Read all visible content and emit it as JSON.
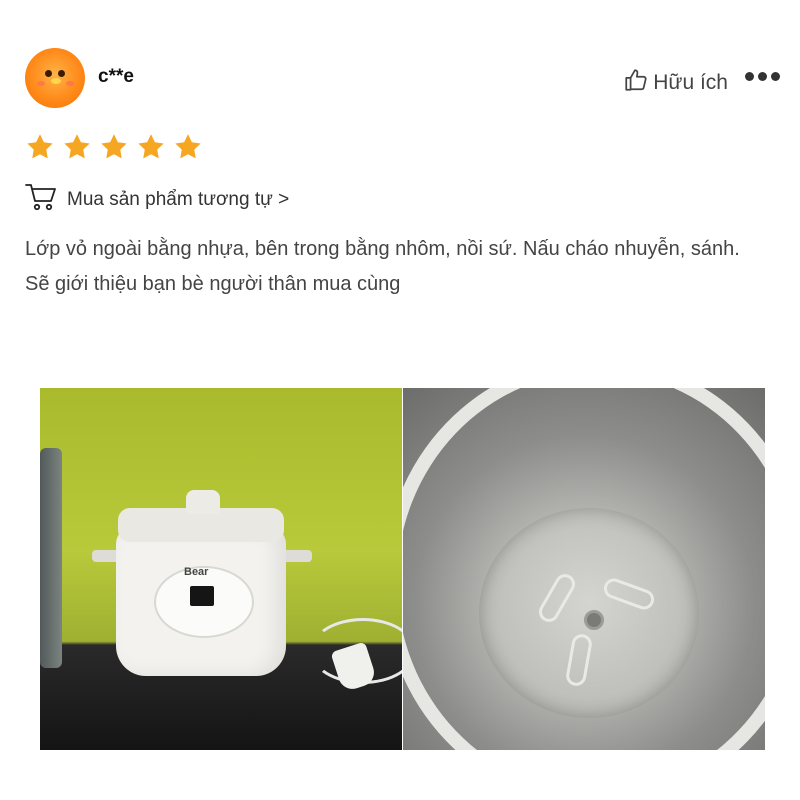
{
  "review": {
    "username": "c**e",
    "helpful_label": "Hữu ích",
    "rating": 5,
    "max_rating": 5,
    "buy_similar_label": "Mua sản phẩm tương tự >",
    "text_line1": "Lớp vỏ ngoài bằng nhựa, bên trong bằng nhôm, nồi sứ. Nấu cháo nhuyễn, sánh.",
    "text_line2": "Sẽ giới thiệu bạn bè người thân mua cùng",
    "photo1_logo": "Bear",
    "star_color": "#f5a623",
    "icons": [
      "avatar",
      "thumbs-up-icon",
      "more-dots-icon",
      "star-icon",
      "shopping-cart-icon"
    ]
  }
}
